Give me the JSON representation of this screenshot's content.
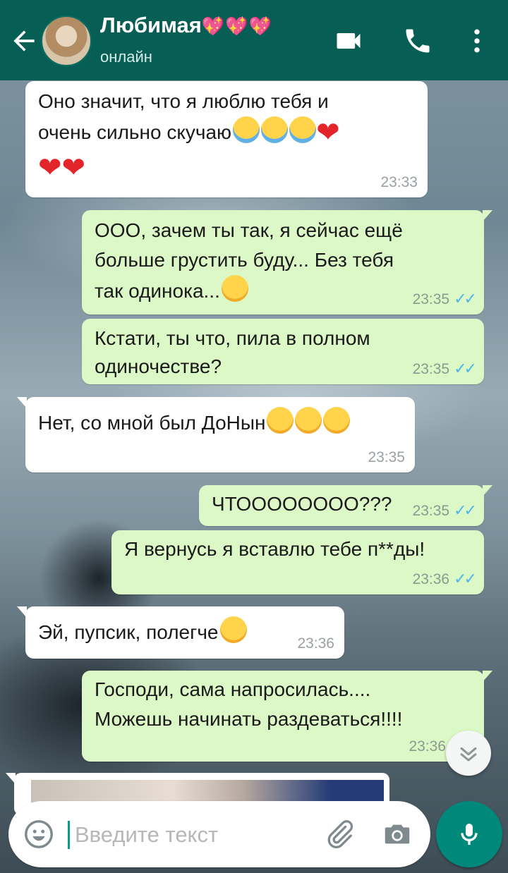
{
  "header": {
    "contact_name": "Любимая",
    "hearts": "💖💖💖",
    "status": "онлайн"
  },
  "messages": [
    {
      "direction": "in",
      "lines": [
        "Оно значит, что я люблю тебя и",
        "очень сильно скучаю",
        ""
      ],
      "time": "23:33"
    },
    {
      "direction": "out",
      "lines": [
        "ООО, зачем ты так, я сейчас ещё",
        "больше грустить буду... Без тебя",
        "так одинока..."
      ],
      "time": "23:35"
    },
    {
      "direction": "out",
      "lines": [
        "Кстати, ты что, пила в полном",
        "одиночестве?"
      ],
      "time": "23:35"
    },
    {
      "direction": "in",
      "lines": [
        "Нет, со мной был ДоНын"
      ],
      "time": "23:35"
    },
    {
      "direction": "out",
      "lines": [
        "ЧТОООООООО???"
      ],
      "time": "23:35"
    },
    {
      "direction": "out",
      "lines": [
        "Я вернусь я вставлю тебе п**ды!"
      ],
      "time": "23:36"
    },
    {
      "direction": "in",
      "lines": [
        "Эй, пупсик, полегче"
      ],
      "time": "23:36"
    },
    {
      "direction": "out",
      "lines": [
        "Господи, сама напросилась....",
        "Можешь начинать раздеваться!!!!"
      ],
      "time": "23:36"
    }
  ],
  "input": {
    "placeholder": "Введите текст"
  },
  "colors": {
    "header": "#075e54",
    "outgoing_bubble": "#dcf8c6",
    "incoming_bubble": "#ffffff",
    "read_ticks": "#4fb6ec",
    "mic_button": "#00897b"
  },
  "icons": [
    "back-arrow-icon",
    "video-call-icon",
    "phone-icon",
    "more-vert-icon",
    "emoji-icon",
    "attach-icon",
    "camera-icon",
    "mic-icon",
    "scroll-down-icon"
  ]
}
